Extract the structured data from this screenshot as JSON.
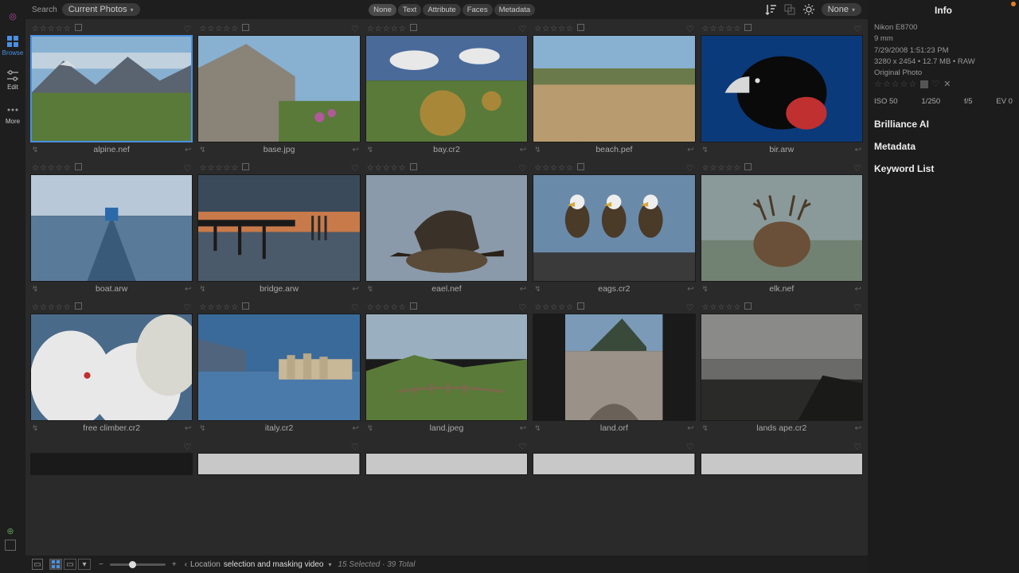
{
  "rail": {
    "browse": "Browse",
    "edit": "Edit",
    "more": "More"
  },
  "top": {
    "search": "Search",
    "scope": "Current Photos",
    "filters": {
      "none": "None",
      "text": "Text",
      "attribute": "Attribute",
      "faces": "Faces",
      "metadata": "Metadata"
    },
    "sort_none": "None"
  },
  "photos": [
    {
      "name": "alpine.nef",
      "selected": true,
      "thumb": "alpine"
    },
    {
      "name": "base.jpg",
      "selected": false,
      "thumb": "base"
    },
    {
      "name": "bay.cr2",
      "selected": false,
      "thumb": "bay"
    },
    {
      "name": "beach.pef",
      "selected": false,
      "thumb": "beach"
    },
    {
      "name": "bir.arw",
      "selected": false,
      "thumb": "bird"
    },
    {
      "name": "boat.arw",
      "selected": false,
      "thumb": "boat"
    },
    {
      "name": "bridge.arw",
      "selected": false,
      "thumb": "bridge"
    },
    {
      "name": "eael.nef",
      "selected": false,
      "thumb": "eagle1"
    },
    {
      "name": "eags.cr2",
      "selected": false,
      "thumb": "eagle2"
    },
    {
      "name": "elk.nef",
      "selected": false,
      "thumb": "elk"
    },
    {
      "name": "free climber.cr2",
      "selected": false,
      "thumb": "climber"
    },
    {
      "name": "italy.cr2",
      "selected": false,
      "thumb": "italy"
    },
    {
      "name": "land.jpeg",
      "selected": false,
      "thumb": "land"
    },
    {
      "name": "land.orf",
      "selected": false,
      "thumb": "land2",
      "narrow": true
    },
    {
      "name": "lands ape.cr2",
      "selected": false,
      "thumb": "seascape"
    }
  ],
  "info": {
    "title": "Info",
    "camera": "Nikon E8700",
    "focal": "9 mm",
    "date": "7/29/2008 1:51:23 PM",
    "dims": "3280 x 2454  •  12.7 MB  •  RAW",
    "original": "Original Photo",
    "iso": "ISO 50",
    "shutter": "1/250",
    "aperture": "f/5",
    "ev": "EV 0",
    "sections": {
      "brilliance": "Brilliance AI",
      "metadata": "Metadata",
      "keywords": "Keyword List"
    }
  },
  "bottom": {
    "location_label": "Location",
    "location": "selection and masking video",
    "status": "15 Selected · 39 Total"
  }
}
